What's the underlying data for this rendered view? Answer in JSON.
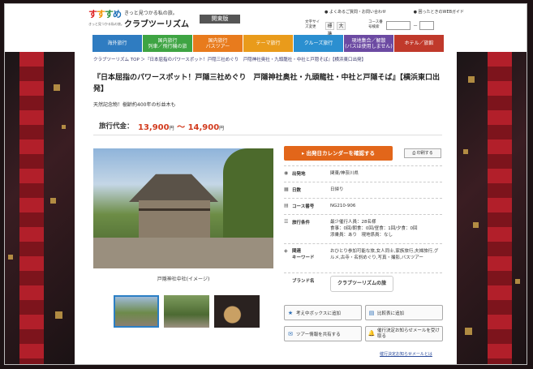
{
  "header": {
    "logo_chars": [
      "す",
      "す",
      "す",
      "め"
    ],
    "logo_sub": "きっと見つかる私の旅。",
    "tagline": "きっと見つかる私の旅。",
    "brand": "クラブツーリズム",
    "region": "関東版",
    "links": [
      "よくあるご質問・お問い合わせ",
      "困ったときのWEBガイド"
    ],
    "text_size_label": "文字サイズ変更",
    "text_size_options": [
      "標準",
      "大"
    ],
    "course_label": "コース番号検索",
    "course_dash": "－",
    "course_placeholder": ""
  },
  "nav": {
    "items": [
      {
        "label": "海外旅行",
        "color": "#2f7cc1"
      },
      {
        "label": "国内旅行\n列車／飛行機の旅",
        "color": "#3ea443"
      },
      {
        "label": "国内旅行\nバスツアー",
        "color": "#e87b1d"
      },
      {
        "label": "テーマ旅行",
        "color": "#e99b1b"
      },
      {
        "label": "クルーズ旅行",
        "color": "#2b8fd0"
      },
      {
        "label": "現地集合／解散\n(バスは使用しません)",
        "color": "#6c4aa2"
      },
      {
        "label": "ホテル／旅館",
        "color": "#c0392b"
      }
    ]
  },
  "content": {
    "breadcrumb": "クラブツーリズム TOP ＞『日本屈指のパワースポット！戸隠三社めぐり　戸隠神社奥社・九頭龍社・中社と戸隠そば』【横浜東口出発】",
    "title": "『日本屈指のパワースポット！戸隠三社めぐり　戸隠神社奥社・九頭龍社・中社と戸隠そば』【横浜東口出発】",
    "subtitle": "天然記念物！樹齢約400年の杉並木も",
    "price_label": "旅行代金：",
    "price_low": "13,900",
    "price_high": "14,900",
    "price_unit": "円",
    "price_sep": "～",
    "photo_caption": "戸隠神社中社(イメージ)",
    "calendar_button": "出発日カレンダーを確認する",
    "print_button": "印刷する",
    "info": [
      {
        "icon": "pin-icon",
        "glyph": "◉",
        "key": "出発地",
        "value": "関東/神奈川県"
      },
      {
        "icon": "calendar-icon",
        "glyph": "▦",
        "key": "日数",
        "value": "日帰り"
      },
      {
        "icon": "doc-icon",
        "glyph": "▤",
        "key": "コース番号",
        "value": "NG210-906"
      },
      {
        "icon": "list-icon",
        "glyph": "☰",
        "key": "旅行条件",
        "value": "最少催行人員：28名様\n食事：0回/朝食：0回/昼食：1回/夕食：0回\n添乗員：あり　現地係員：なし"
      },
      {
        "icon": "tag-icon",
        "glyph": "◈",
        "key": "関連\nキーワード",
        "value": "おひとり参加可能な旅,女人同士,家族旅行,夫婦旅行,グルメ,古寺・名刹めぐり,写真・撮影,バスツアー"
      }
    ],
    "brand_label": "ブランド名",
    "brand_value": "クラブツーリズムの旅",
    "actions": [
      {
        "label": "考え中ボックスに追加",
        "glyph": "★"
      },
      {
        "label": "比較表に追加",
        "glyph": "▤"
      },
      {
        "label": "ツアー情報を共有する",
        "glyph": "✉"
      },
      {
        "label": "催行決定お知らせメールを受け取る",
        "glyph": "🔔"
      }
    ],
    "bottom_link": "催行決定お知らせメールとは"
  }
}
